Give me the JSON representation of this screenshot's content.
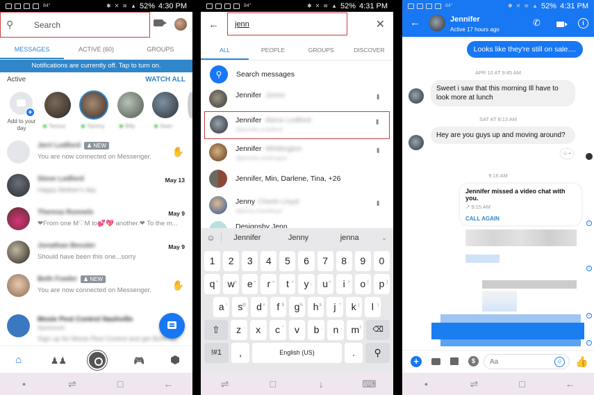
{
  "status_bars": [
    {
      "time": "4:30 PM",
      "battery": "52%",
      "temp": "84°"
    },
    {
      "time": "4:31 PM",
      "battery": "52%",
      "temp": "84°"
    },
    {
      "time": "4:31 PM",
      "battery": "52%",
      "temp": "84°"
    }
  ],
  "inbox": {
    "search_placeholder": "Search",
    "tabs": [
      {
        "label": "MESSAGES",
        "active": true
      },
      {
        "label": "ACTIVE (60)",
        "active": false
      },
      {
        "label": "GROUPS",
        "active": false
      }
    ],
    "notification_banner": "Notifications are currently off. Tap to turn on.",
    "active_label": "Active",
    "watch_all": "WATCH ALL",
    "add_to_day": "Add to your day",
    "stories": [
      {
        "name": "Teresa"
      },
      {
        "name": "Tammy"
      },
      {
        "name": "Billy"
      },
      {
        "name": "Sean"
      }
    ],
    "conversations": [
      {
        "name": "Jerri Ledford",
        "badge": "NEW",
        "snippet": "You are now connected on Messenger.",
        "date": "",
        "wave": true,
        "blur_snippet": false
      },
      {
        "name": "Steve Ledford",
        "badge": "",
        "snippet": "Happy Mother's day",
        "date": "May 13",
        "wave": false,
        "blur_snippet": true
      },
      {
        "name": "Theresa Runnels",
        "badge": "",
        "snippet": "❤From one M♡M to💕💖 another.❤ To the m...",
        "date": "May 9",
        "wave": false,
        "blur_snippet": false
      },
      {
        "name": "Jonathan Bessler",
        "badge": "",
        "snippet": "Should have been this one...sorry",
        "date": "May 9",
        "wave": false,
        "blur_snippet": false
      },
      {
        "name": "Beth Fowler",
        "badge": "NEW",
        "snippet": "You are now connected on Messenger.",
        "date": "",
        "wave": true,
        "blur_snippet": false
      },
      {
        "name": "Moxie Pest Control Nashville",
        "badge": "",
        "snippet": "Sign up for Moxie Pest Control and get $100 off.",
        "date": "",
        "wave": false,
        "blur_snippet": true,
        "sponsored": "Sponsored"
      }
    ],
    "bottom_tabs": [
      "home",
      "people",
      "camera",
      "games",
      "discover"
    ]
  },
  "search": {
    "query": "jenn",
    "tabs": [
      {
        "label": "ALL",
        "active": true
      },
      {
        "label": "PEOPLE",
        "active": false
      },
      {
        "label": "GROUPS",
        "active": false
      },
      {
        "label": "DISCOVER",
        "active": false
      }
    ],
    "search_messages": "Search messages",
    "results": [
      {
        "first": "Jennifer",
        "rest": "Jones",
        "sub": "",
        "highlighted": false,
        "more": true
      },
      {
        "first": "Jennifer",
        "rest": "Alene Ledford",
        "sub": "@jennifer.a.ledford",
        "highlighted": true,
        "more": true
      },
      {
        "first": "Jennifer",
        "rest": "Whittington",
        "sub": "@jennifer.whittington",
        "highlighted": false,
        "more": true
      },
      {
        "first": "Jennifer, Min, Darlene, Tina, +26",
        "rest": "",
        "sub": "",
        "highlighted": false,
        "more": false
      },
      {
        "first": "Jenny",
        "rest": "Cheek-Lloyd",
        "sub": "@jenny.cheeklloyd",
        "highlighted": false,
        "more": true
      },
      {
        "first": "Designsby Jenn",
        "rest": "",
        "sub": "",
        "highlighted": false,
        "more": true
      }
    ],
    "keyboard": {
      "suggestions": [
        "Jennifer",
        "Jenny",
        "jenna"
      ],
      "numbers": [
        "1",
        "2",
        "3",
        "4",
        "5",
        "6",
        "7",
        "8",
        "9",
        "0"
      ],
      "row1": [
        [
          "q",
          "+"
        ],
        [
          "w",
          "×"
        ],
        [
          "e",
          "÷"
        ],
        [
          "r",
          "="
        ],
        [
          "t",
          "/"
        ],
        [
          "y",
          "_"
        ],
        [
          "u",
          "<"
        ],
        [
          "i",
          ">"
        ],
        [
          "o",
          "["
        ],
        [
          "p",
          "]"
        ]
      ],
      "row2": [
        [
          "a",
          "!"
        ],
        [
          "s",
          "@"
        ],
        [
          "d",
          "#"
        ],
        [
          "f",
          "$"
        ],
        [
          "g",
          "%"
        ],
        [
          "h",
          "&"
        ],
        [
          "j",
          "*"
        ],
        [
          "k",
          "("
        ],
        [
          "l",
          ")"
        ]
      ],
      "row3": [
        [
          "z",
          "-"
        ],
        [
          "x",
          "'"
        ],
        [
          "c",
          "\""
        ],
        [
          "v",
          ":"
        ],
        [
          "b",
          ";"
        ],
        [
          "n",
          ","
        ],
        [
          "m",
          "?"
        ]
      ],
      "symbols": "!#1",
      "comma": ",",
      "space": "English (US)",
      "period": "."
    }
  },
  "chat": {
    "contact_name": "Jennifer",
    "contact_status": "Active 17 hours ago",
    "outgoing_1": "Looks like they're still on sale....",
    "ts_1": "APR 10 AT 9:45 AM",
    "incoming_1": "Sweet i saw that this morning Ill have to look more at lunch",
    "ts_2": "SAT AT 8:13 AM",
    "incoming_2": "Hey are you guys up and moving around?",
    "ts_3": "9:16 AM",
    "missed_call_title": "Jennifer missed a video chat with you.",
    "missed_call_time": "↗ 9:15 AM",
    "call_again": "CALL AGAIN",
    "composer_placeholder": "Aa",
    "accent": "#1877f2"
  }
}
